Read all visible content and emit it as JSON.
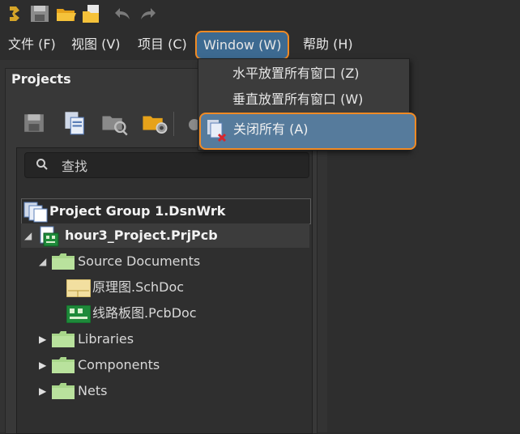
{
  "menubar": {
    "file": "文件 (F)",
    "view": "视图 (V)",
    "project": "项目 (C)",
    "window": "Window (W)",
    "help": "帮助 (H)"
  },
  "window_menu": {
    "items": [
      {
        "label": "水平放置所有窗口 (Z)"
      },
      {
        "label": "垂直放置所有窗口 (W)"
      },
      {
        "label": "关闭所有 (A)"
      }
    ]
  },
  "panel": {
    "title": "Projects",
    "search_placeholder": "查找"
  },
  "tree": {
    "group": "Project Group 1.DsnWrk",
    "project": "hour3_Project.PrjPcb",
    "source_docs": "Source Documents",
    "schdoc": "原理图.SchDoc",
    "pcbdoc": "线路板图.PcbDoc",
    "libraries": "Libraries",
    "components": "Components",
    "nets": "Nets"
  },
  "colors": {
    "highlight": "#567b9c",
    "callout": "#f08a24",
    "folder": "#a8d68a"
  }
}
